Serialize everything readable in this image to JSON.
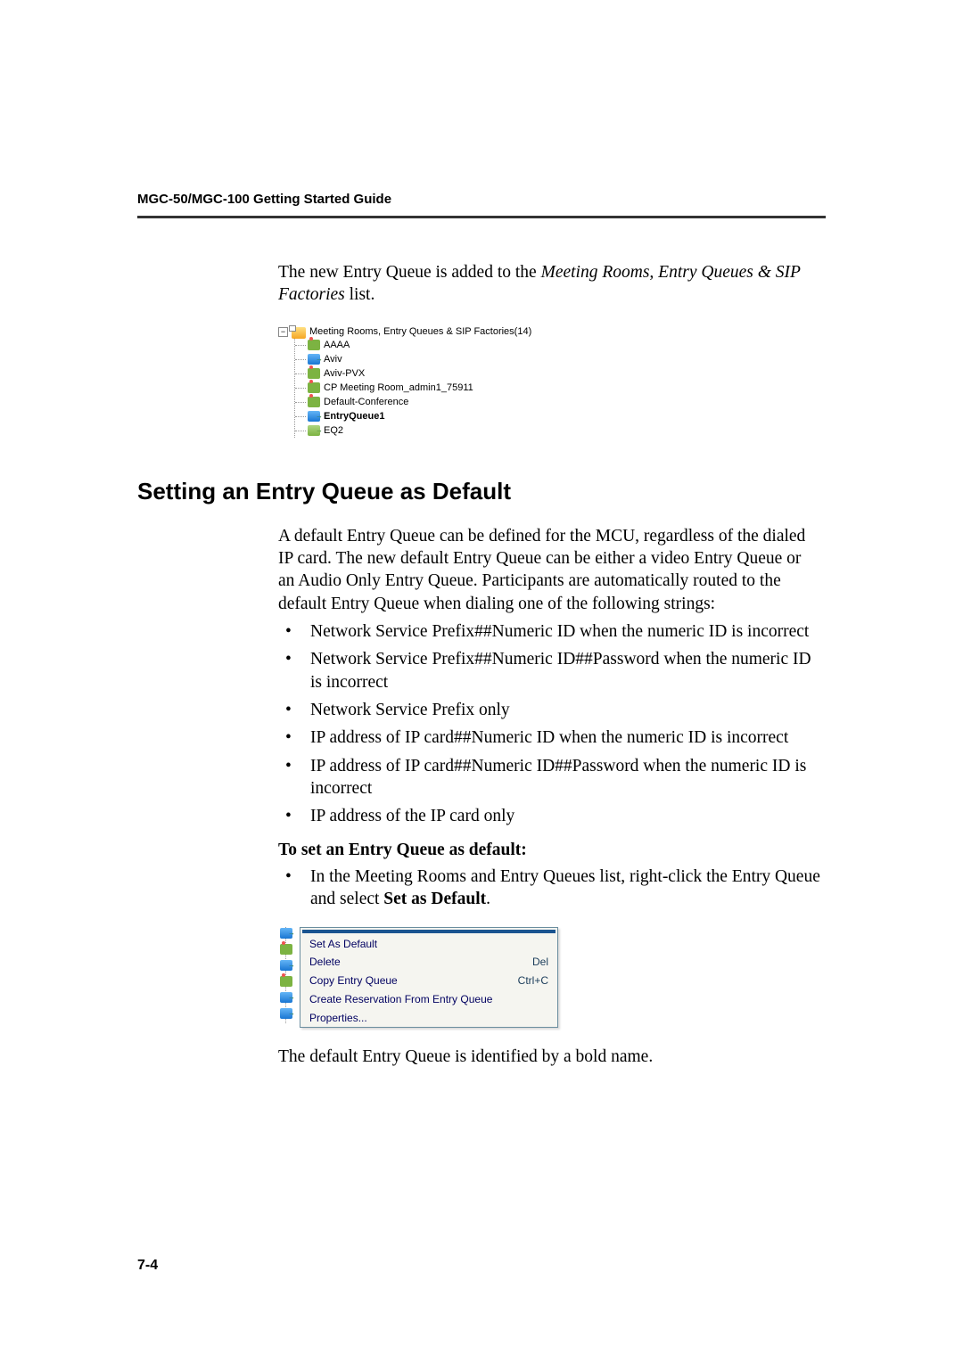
{
  "header": {
    "title": "MGC-50/MGC-100 Getting Started Guide"
  },
  "intro": {
    "prefix": "The new Entry Queue is added to the ",
    "italic": "Meeting Rooms, Entry Queues & SIP Factories",
    "suffix": " list."
  },
  "tree1": {
    "root": "Meeting Rooms, Entry Queues & SIP Factories(14)",
    "items": [
      {
        "label": "AAAA",
        "type": "meeting",
        "bold": false
      },
      {
        "label": "Aviv",
        "type": "eq",
        "bold": false
      },
      {
        "label": "Aviv-PVX",
        "type": "meeting",
        "bold": false
      },
      {
        "label": "CP Meeting Room_admin1_75911",
        "type": "meeting",
        "bold": false
      },
      {
        "label": "Default-Conference",
        "type": "meeting",
        "bold": false
      },
      {
        "label": "EntryQueue1",
        "type": "eq",
        "bold": true
      },
      {
        "label": "EQ2",
        "type": "eq2",
        "bold": false
      }
    ]
  },
  "section": {
    "heading": "Setting an Entry Queue as Default",
    "para": "A default Entry Queue can be defined for the MCU, regardless of the dialed IP card. The new default Entry Queue can be either a video Entry Queue or an Audio Only Entry Queue. Participants are automatically routed to the default Entry Queue when dialing one of the following strings:",
    "bullets": [
      "Network Service Prefix##Numeric ID when the numeric ID is incorrect",
      "Network Service Prefix##Numeric ID##Password when the numeric ID is incorrect",
      "Network Service Prefix only",
      "IP address of IP card##Numeric ID when the numeric ID is incorrect",
      "IP address of IP card##Numeric ID##Password when the numeric ID is incorrect",
      "IP address of the IP card only"
    ],
    "sub_head": "To set an Entry Queue as default:",
    "step_prefix": "In the Meeting Rooms and Entry Queues list, right-click the Entry Queue and select ",
    "step_bold": "Set as Default",
    "step_suffix": "."
  },
  "context_menu": {
    "items": [
      {
        "label": "Set As Default",
        "shortcut": ""
      },
      {
        "label": "Delete",
        "shortcut": "Del"
      },
      {
        "label": "Copy Entry Queue",
        "shortcut": "Ctrl+C"
      },
      {
        "label": "Create Reservation From Entry Queue",
        "shortcut": ""
      },
      {
        "label": "Properties...",
        "shortcut": ""
      }
    ]
  },
  "closing": "The default Entry Queue is identified by a bold name.",
  "footer": {
    "page": "7-4"
  }
}
